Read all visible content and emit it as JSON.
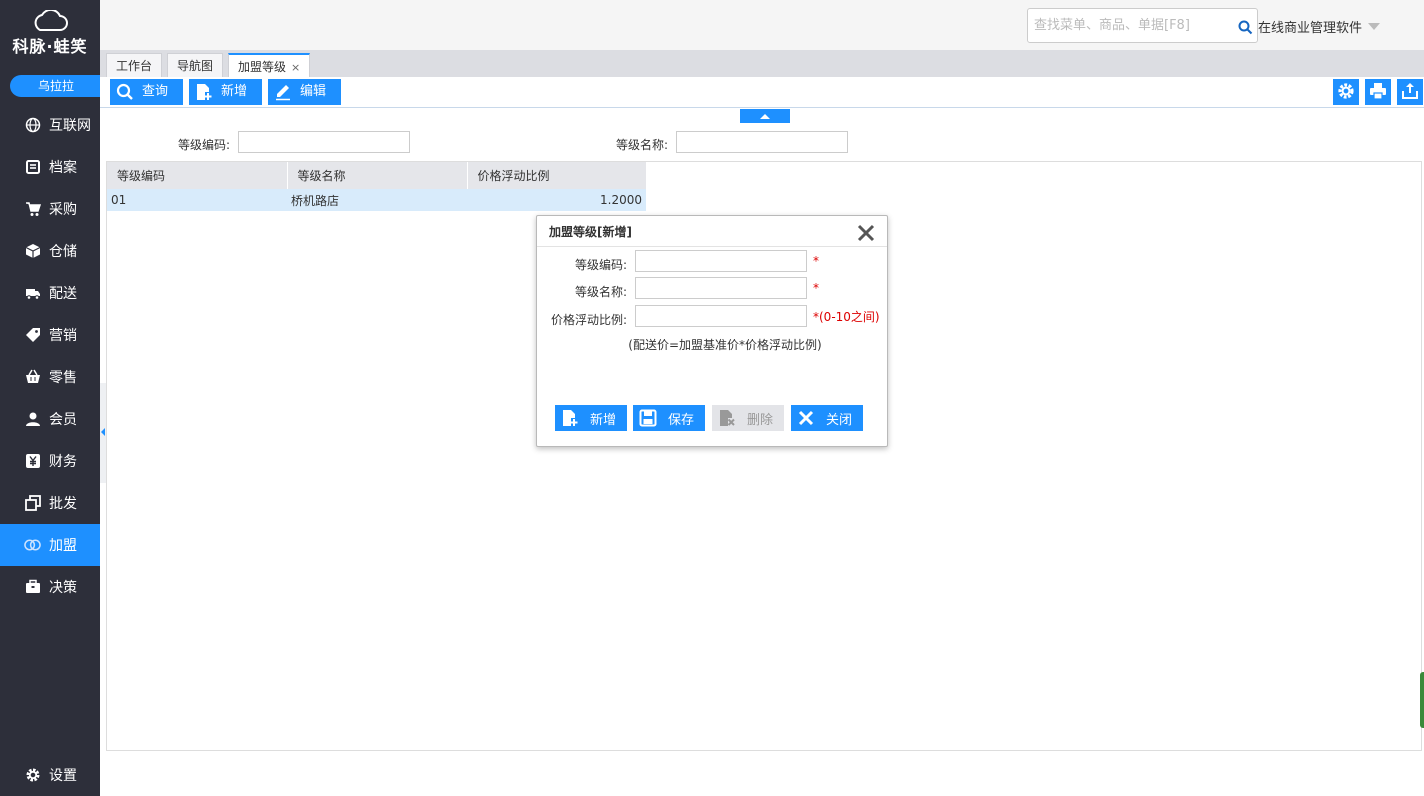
{
  "app": {
    "logo_text": "科脉·蛙笑",
    "user_name": "乌拉拉",
    "product_name": "在线商业管理软件"
  },
  "colors": {
    "accent": "#1e90ff",
    "sidebar_bg": "#2d2f3a",
    "required": "#dd0000"
  },
  "search": {
    "placeholder": "查找菜单、商品、单据[F8]"
  },
  "sidebar": {
    "items": [
      {
        "label": "互联网",
        "icon": "globe-icon"
      },
      {
        "label": "档案",
        "icon": "archive-icon"
      },
      {
        "label": "采购",
        "icon": "cart-icon"
      },
      {
        "label": "仓储",
        "icon": "box-icon"
      },
      {
        "label": "配送",
        "icon": "truck-icon"
      },
      {
        "label": "营销",
        "icon": "tag-icon"
      },
      {
        "label": "零售",
        "icon": "basket-icon"
      },
      {
        "label": "会员",
        "icon": "user-icon"
      },
      {
        "label": "财务",
        "icon": "yen-icon"
      },
      {
        "label": "批发",
        "icon": "copy-icon"
      },
      {
        "label": "加盟",
        "icon": "rings-icon",
        "active": true
      },
      {
        "label": "决策",
        "icon": "briefcase-icon"
      }
    ],
    "settings_label": "设置"
  },
  "tabs": [
    {
      "label": "工作台"
    },
    {
      "label": "导航图"
    },
    {
      "label": "加盟等级",
      "active": true,
      "close": "×"
    }
  ],
  "toolbar": {
    "query": "查询",
    "add": "新增",
    "edit": "编辑"
  },
  "filters": {
    "code_label": "等级编码:",
    "name_label": "等级名称:"
  },
  "grid": {
    "columns": [
      "等级编码",
      "等级名称",
      "价格浮动比例"
    ],
    "rows": [
      {
        "code": "01",
        "name": "桥机路店",
        "ratio": "1.2000"
      }
    ]
  },
  "dialog": {
    "title": "加盟等级[新增]",
    "code_label": "等级编码:",
    "name_label": "等级名称:",
    "ratio_label": "价格浮动比例:",
    "required_mark": "*",
    "ratio_hint": "*(0-10之间)",
    "formula": "(配送价=加盟基准价*价格浮动比例)",
    "buttons": {
      "add": "新增",
      "save": "保存",
      "delete": "删除",
      "close": "关闭"
    }
  }
}
